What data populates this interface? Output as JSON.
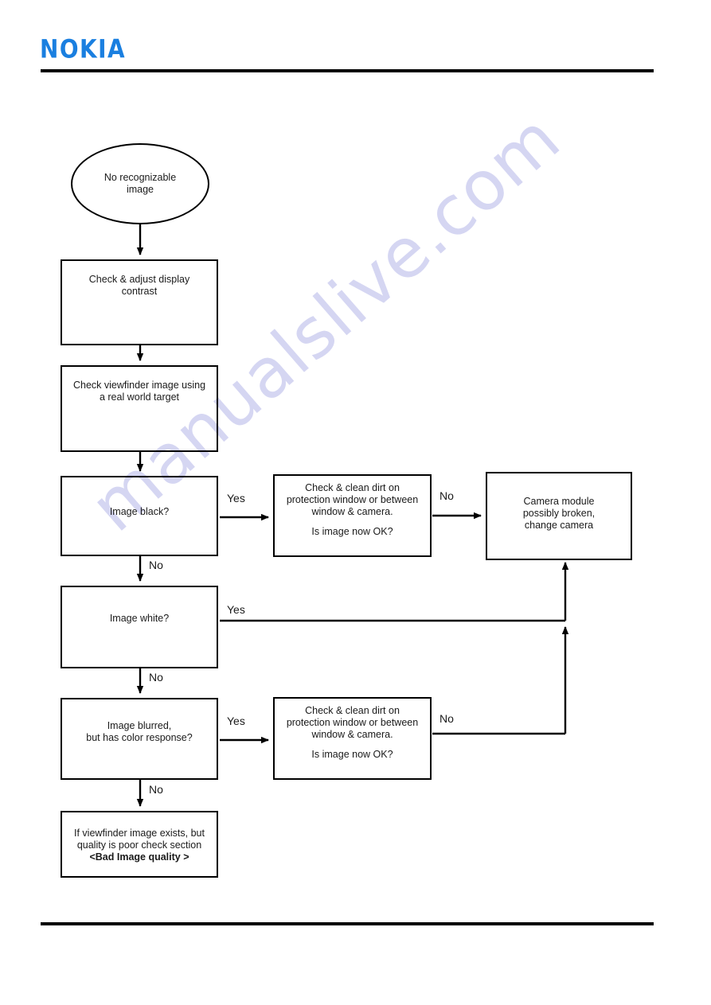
{
  "header": {
    "logo_text": "NOKIA",
    "logo_color": "#1a7fe0"
  },
  "watermark": {
    "text": "manualslive.com",
    "color": "#d5d6f2"
  },
  "flowchart": {
    "title": "No recognizable image troubleshooting",
    "nodes": {
      "start": {
        "shape": "ellipse",
        "line1": "No recognizable",
        "line2": "image"
      },
      "contrast": {
        "shape": "rect",
        "line1": "Check & adjust display",
        "line2": "contrast"
      },
      "viewfinder": {
        "shape": "rect",
        "line1": "Check viewfinder image using",
        "line2": "a real world target"
      },
      "image_black": {
        "shape": "rect",
        "line1": "Image black?"
      },
      "clean_dirt_1": {
        "shape": "rect",
        "line1": "Check & clean dirt on",
        "line2": "protection window or between",
        "line3": "window & camera.",
        "line4": "Is image now OK?"
      },
      "camera_broken": {
        "shape": "rect",
        "line1": "Camera module",
        "line2": "possibly broken,",
        "line3": "change camera"
      },
      "image_white": {
        "shape": "rect",
        "line1": "Image white?"
      },
      "image_blurred": {
        "shape": "rect",
        "line1": "Image blurred,",
        "line2": "but has color response?"
      },
      "clean_dirt_2": {
        "shape": "rect",
        "line1": "Check & clean dirt on",
        "line2": "protection window or between",
        "line3": "window & camera.",
        "line4": "Is image now OK?"
      },
      "bad_quality": {
        "shape": "rect",
        "line1": "If viewfinder image exists, but",
        "line2": "quality is poor check section",
        "line3": "<Bad Image quality >"
      }
    },
    "edge_labels": {
      "black_yes": "Yes",
      "black_no": "No",
      "dirt1_no": "No",
      "white_yes": "Yes",
      "white_no": "No",
      "blurred_yes": "Yes",
      "blurred_no": "No",
      "dirt2_no": "No"
    }
  }
}
